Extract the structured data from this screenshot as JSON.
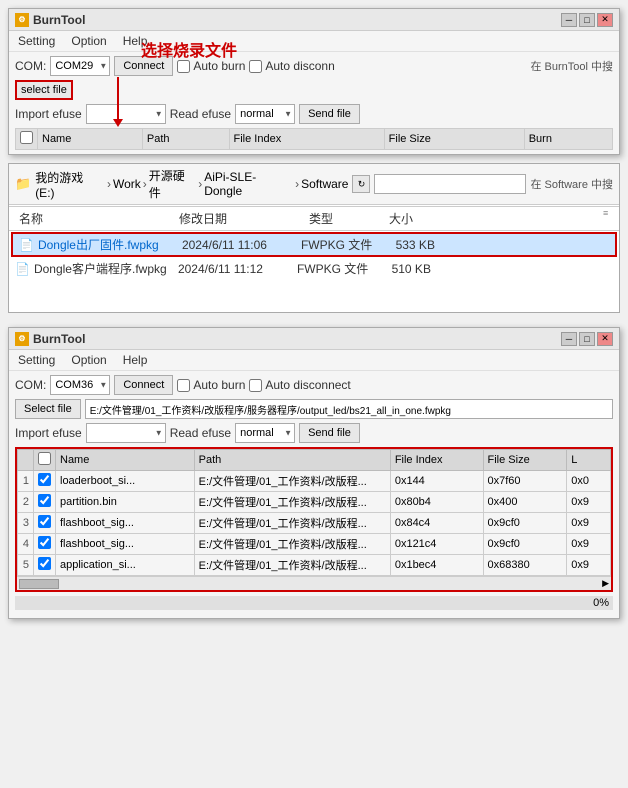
{
  "topWindow": {
    "title": "BurnTool",
    "menuItems": [
      "Setting",
      "Option",
      "Help"
    ],
    "annotation": "选择烧录文件",
    "sideAnnotation": "在 BurnTool 中搜",
    "comLabel": "COM:",
    "comValue": "COM29",
    "connectBtn": "Connect",
    "autoBurn": "Auto burn",
    "autoDisconn": "Auto disconn",
    "selectFileLabel": "select file",
    "importEfuseLabel": "Import efuse",
    "readEfuseLabel": "Read efuse",
    "readEfuseValue": "normal",
    "sendFileBtn": "Send file",
    "tableHeaders": [
      "",
      "Name",
      "Path",
      "File Index",
      "File Size",
      "Burn"
    ]
  },
  "fileExplorer": {
    "sideAnnotation": "在 Software 中搜",
    "pathParts": [
      "我的游戏 (E:)",
      "Work",
      "开源硬件",
      "AiPi-SLE-Dongle",
      "Software"
    ],
    "columns": [
      "名称",
      "修改日期",
      "类型",
      "大小"
    ],
    "files": [
      {
        "name": "Dongle出厂固件.fwpkg",
        "date": "2024/6/11 11:06",
        "type": "FWPKG 文件",
        "size": "533 KB",
        "highlighted": true
      },
      {
        "name": "Dongle客户端程序.fwpkg",
        "date": "2024/6/11 11:12",
        "type": "FWPKG 文件",
        "size": "510 KB",
        "highlighted": false
      }
    ]
  },
  "bottomWindow": {
    "title": "BurnTool",
    "menuItems": [
      "Setting",
      "Option",
      "Help"
    ],
    "comLabel": "COM:",
    "comValue": "COM36",
    "connectBtn": "Connect",
    "autoBurn": "Auto burn",
    "autoDisconnect": "Auto disconnect",
    "selectFileBtn": "Select file",
    "selectFilePath": "E:/文件管理/01_工作资料/改版程序/服务器程序/output_led/bs21_all_in_one.fwpkg",
    "importEfuseLabel": "Import efuse",
    "readEfuseLabel": "Read efuse",
    "readEfuseValue": "normal",
    "sendFileBtn": "Send file",
    "tableHeaders": [
      "",
      "Name",
      "Path",
      "File Index",
      "File Size",
      "L"
    ],
    "tableRows": [
      {
        "num": "1",
        "checked": true,
        "name": "loaderboot_si...",
        "path": "E:/文件管理/01_工作资料/改版程...",
        "index": "0x144",
        "size": "0x7f60",
        "last": "0x0"
      },
      {
        "num": "2",
        "checked": true,
        "name": "partition.bin",
        "path": "E:/文件管理/01_工作资料/改版程...",
        "index": "0x80b4",
        "size": "0x400",
        "last": "0x9"
      },
      {
        "num": "3",
        "checked": true,
        "name": "flashboot_sig...",
        "path": "E:/文件管理/01_工作资料/改版程...",
        "index": "0x84c4",
        "size": "0x9cf0",
        "last": "0x9"
      },
      {
        "num": "4",
        "checked": true,
        "name": "flashboot_sig...",
        "path": "E:/文件管理/01_工作资料/改版程...",
        "index": "0x121c4",
        "size": "0x9cf0",
        "last": "0x9"
      },
      {
        "num": "5",
        "checked": true,
        "name": "application_si...",
        "path": "E:/文件管理/01_工作资料/改版程...",
        "index": "0x1bec4",
        "size": "0x68380",
        "last": "0x9"
      }
    ],
    "progress": 0,
    "progressLabel": "0%"
  }
}
